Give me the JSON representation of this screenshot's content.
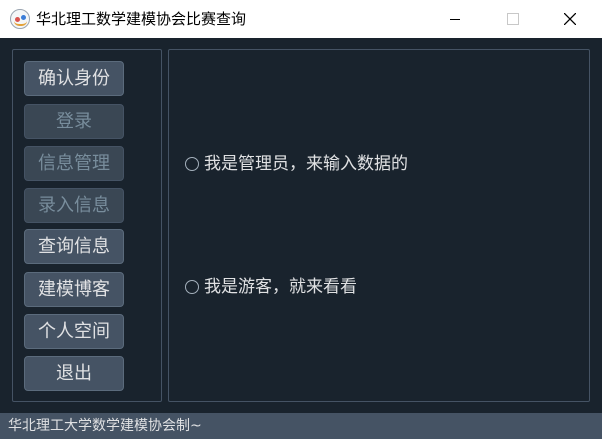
{
  "window": {
    "title": "华北理工数学建模协会比赛查询",
    "app_icon": "app-logo-icon",
    "controls": [
      "minimize-icon",
      "maximize-icon",
      "close-icon"
    ]
  },
  "sidebar": {
    "buttons": [
      {
        "label": "确认身份",
        "enabled": true
      },
      {
        "label": "登录",
        "enabled": false
      },
      {
        "label": "信息管理",
        "enabled": false
      },
      {
        "label": "录入信息",
        "enabled": false
      },
      {
        "label": "查询信息",
        "enabled": true
      },
      {
        "label": "建模博客",
        "enabled": true
      },
      {
        "label": "个人空间",
        "enabled": true
      },
      {
        "label": "退出",
        "enabled": true
      }
    ]
  },
  "main": {
    "role_options": [
      {
        "label": "我是管理员，来输入数据的",
        "checked": false
      },
      {
        "label": "我是游客，就来看看",
        "checked": false
      }
    ]
  },
  "status_bar": {
    "text": "华北理工大学数学建模协会制~"
  },
  "colors": {
    "background": "#19232d",
    "button": "#455364",
    "text": "#e0e1e3",
    "disabled_text": "#788d9c"
  }
}
